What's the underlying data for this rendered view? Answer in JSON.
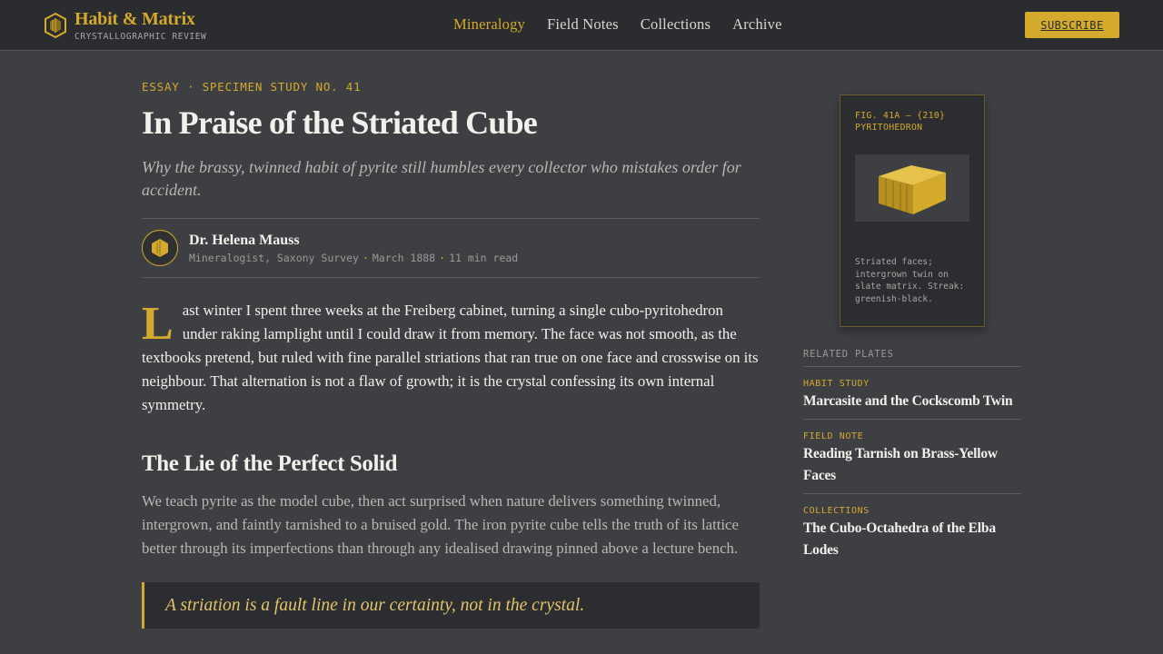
{
  "brand": {
    "title": "Habit & Matrix",
    "subtitle": "CRYSTALLOGRAPHIC REVIEW",
    "logo_icon": "hexagonal-crystal-icon"
  },
  "nav": {
    "items": [
      {
        "label": "Mineralogy",
        "active": true
      },
      {
        "label": "Field Notes",
        "active": false
      },
      {
        "label": "Collections",
        "active": false
      },
      {
        "label": "Archive",
        "active": false
      }
    ],
    "subscribe_label": "SUBSCRIBE"
  },
  "article": {
    "kicker": "ESSAY · SPECIMEN STUDY NO. 41",
    "title": "In Praise of the Striated Cube",
    "dek": "Why the brassy, twinned habit of pyrite still humbles every collector who mistakes order for accident.",
    "author": {
      "name": "Dr. Helena Mauss",
      "role": "Mineralogist, Saxony Survey",
      "date": "March 1888",
      "read_time": "11 min read",
      "separator": "·"
    },
    "lede_dropcap": "L",
    "lede_rest": "ast winter I spent three weeks at the Freiberg cabinet, turning a single cubo-pyritohedron under raking lamplight until I could draw it from memory. The face was not smooth, as the textbooks pretend, but ruled with fine parallel striations that ran true on one face and crosswise on its neighbour. That alternation is not a flaw of growth; it is the crystal confessing its own internal symmetry.",
    "section_heading": "The Lie of the Perfect Solid",
    "section_body": "We teach pyrite as the model cube, then act surprised when nature delivers something twinned, intergrown, and faintly tarnished to a bruised gold. The iron pyrite cube tells the truth of its lattice better through its imperfections than through any idealised drawing pinned above a lecture bench.",
    "pull_quote": "A striation is a fault line in our certainty, not in the crystal."
  },
  "figure": {
    "label": "FIG. 41A — {210} PYRITOHEDRON",
    "caption": "Striated faces; intergrown twin on slate matrix. Streak: greenish-black."
  },
  "related": {
    "heading": "RELATED PLATES",
    "items": [
      {
        "category": "HABIT STUDY",
        "title": "Marcasite and the Cockscomb Twin"
      },
      {
        "category": "FIELD NOTE",
        "title": "Reading Tarnish on Brass-Yellow Faces"
      },
      {
        "category": "COLLECTIONS",
        "title": "The Cubo-Octahedra of the Elba Lodes"
      }
    ]
  },
  "colors": {
    "background": "#3d3f43",
    "header": "#2b2c2f",
    "accent_gold": "#d4aa2c",
    "text": "#f2f0eb",
    "muted_text": "#b9b7b2"
  }
}
